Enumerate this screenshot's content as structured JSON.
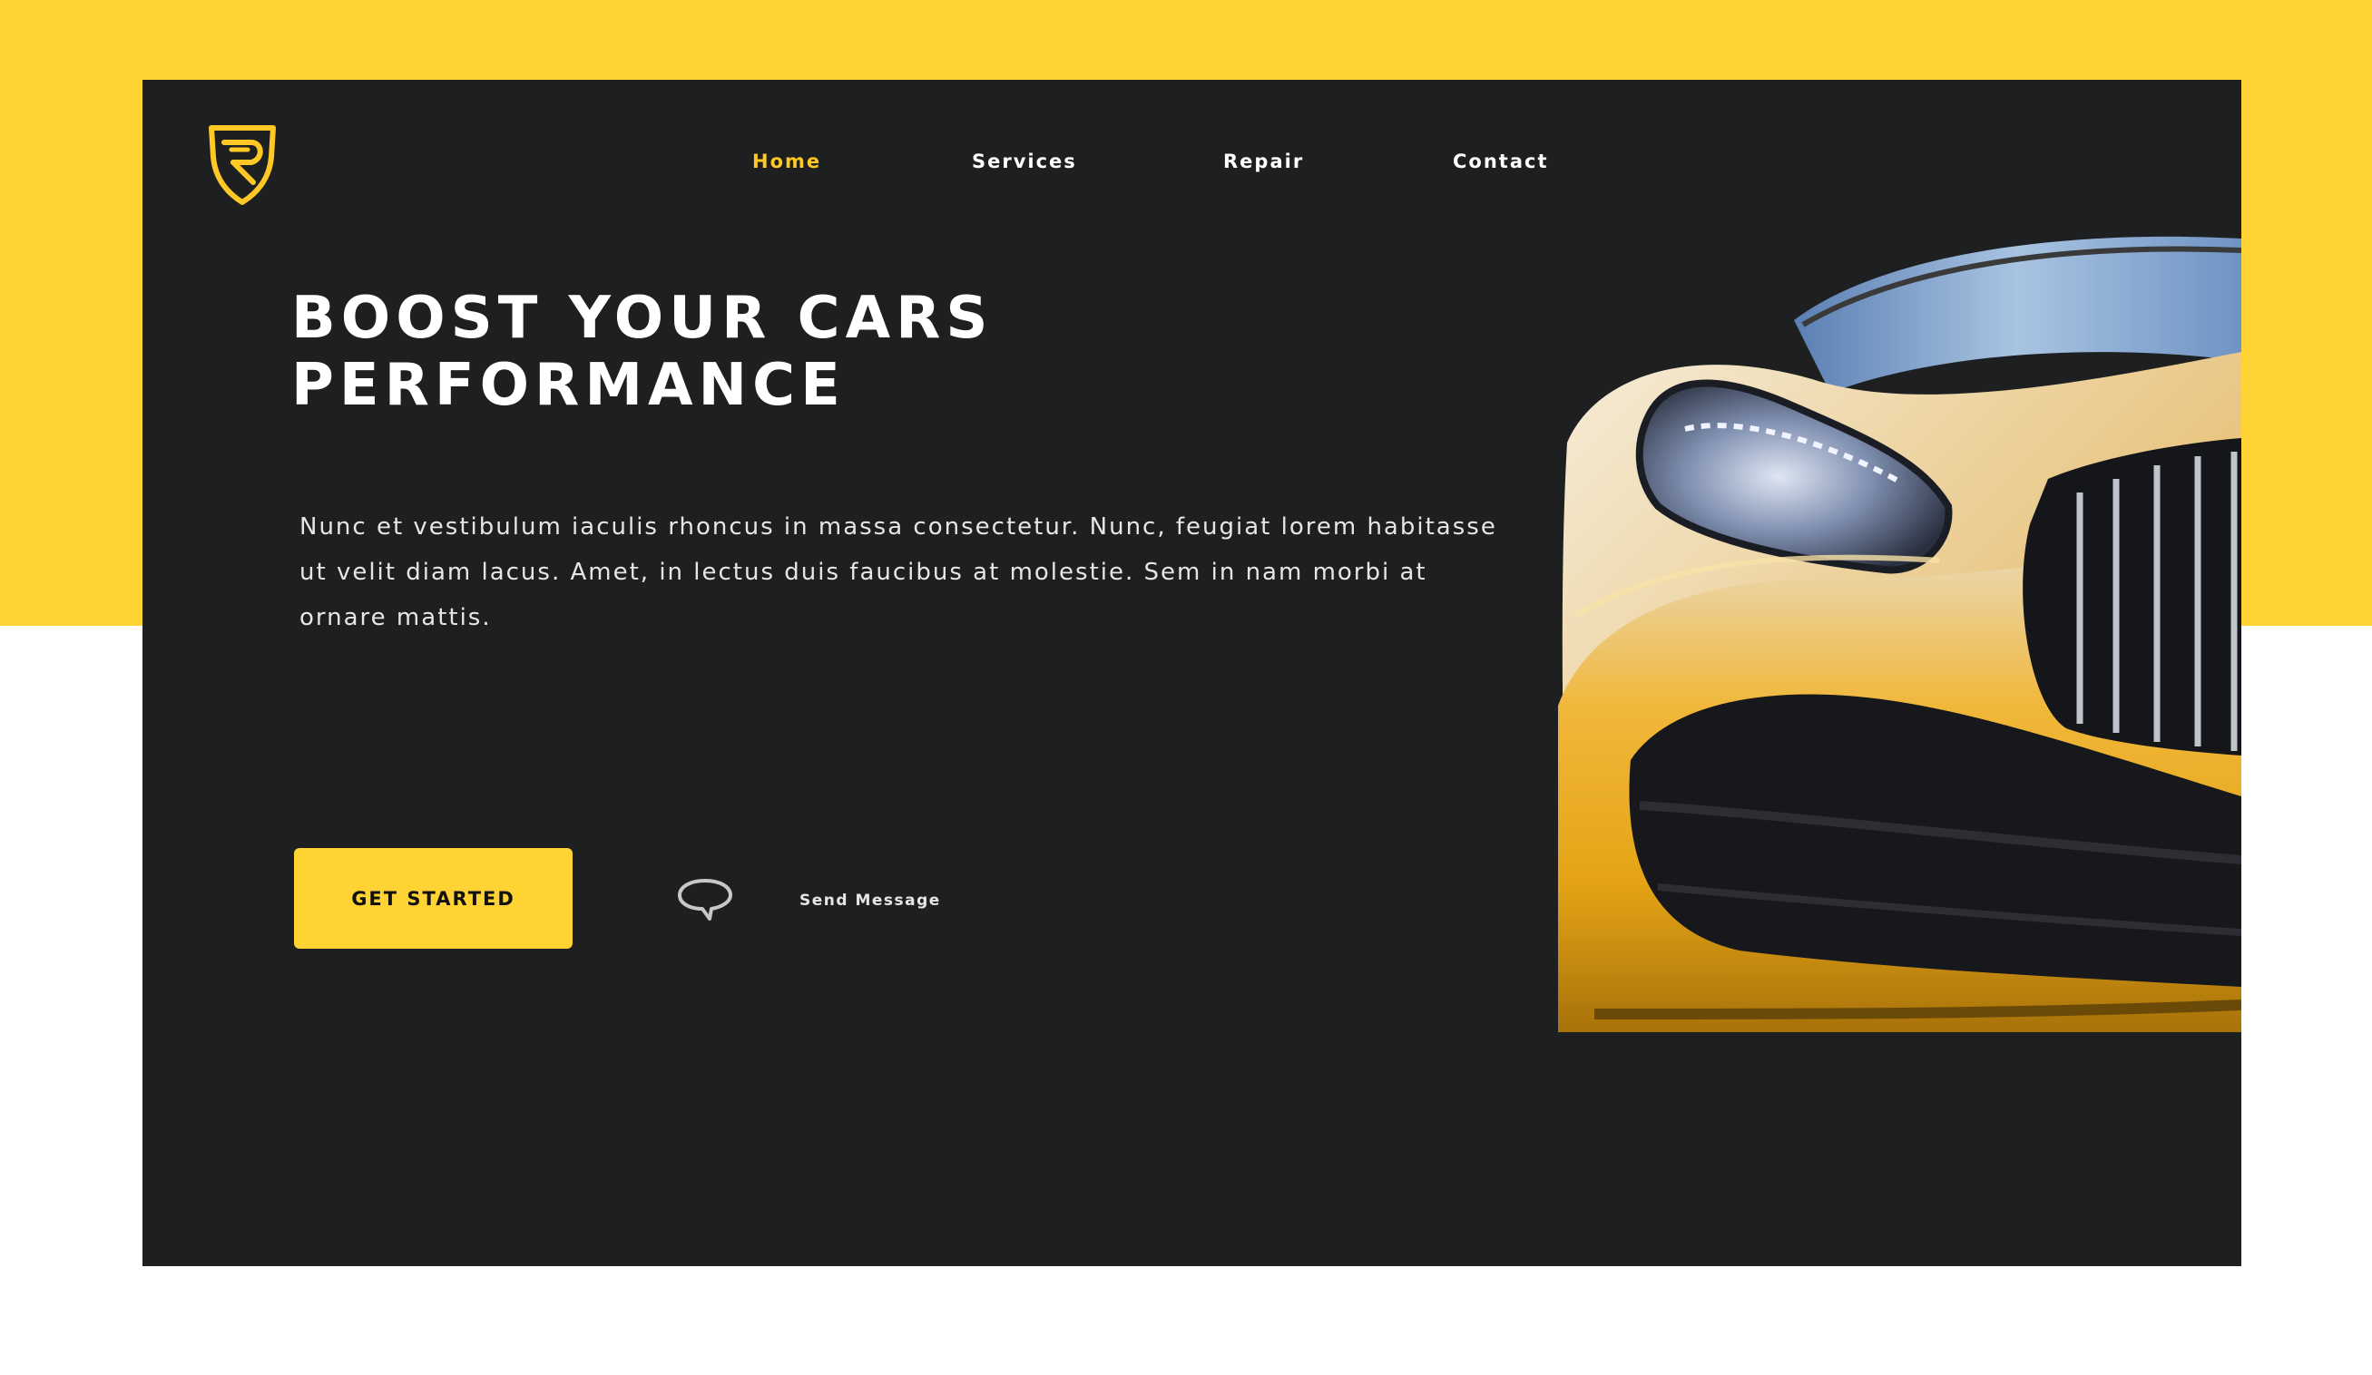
{
  "brand": {
    "logo_icon": "shield-r-logo-icon",
    "accent_color": "#ffd334",
    "background_color": "#1e1f21"
  },
  "nav": {
    "items": [
      {
        "label": "Home",
        "active": true
      },
      {
        "label": "Services",
        "active": false
      },
      {
        "label": "Repair",
        "active": false
      },
      {
        "label": "Contact",
        "active": false
      }
    ]
  },
  "hero": {
    "title_line1": "BOOST YOUR CARS",
    "title_line2": "PERFORMANCE",
    "description": "Nunc et vestibulum iaculis rhoncus in massa consectetur. Nunc, feugiat lorem habitasse ut velit diam lacus. Amet, in lectus duis faucibus at molestie. Sem in nam morbi at ornare mattis.",
    "cta_label": "GET STARTED",
    "message_icon": "speech-bubble-icon",
    "message_label": "Send Message",
    "image_icon": "yellow-sports-car-image"
  }
}
